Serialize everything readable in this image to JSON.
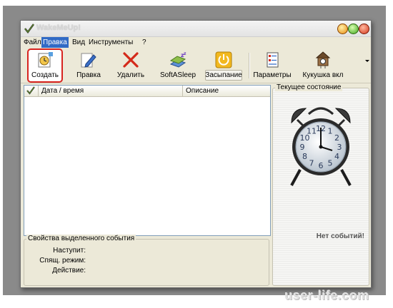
{
  "window": {
    "title": "WakeMeUp!"
  },
  "menu": [
    {
      "label": "Файл"
    },
    {
      "label": "Правка"
    },
    {
      "label": "Вид"
    },
    {
      "label": "Инструменты"
    },
    {
      "label": "?"
    }
  ],
  "toolbar": {
    "create": "Создать",
    "edit": "Правка",
    "delete": "Удалить",
    "softasleep": "SoftASleep",
    "sleep": "Засыпание",
    "params": "Параметры",
    "cuckoo": "Кукушка вкл"
  },
  "list": {
    "columns": {
      "date": "Дата / время",
      "desc": "Описание"
    }
  },
  "props": {
    "title": "Свойства выделенного события",
    "occurs": "Наступит:",
    "sleep_mode": "Спящ. режим:",
    "action": "Действие:"
  },
  "state": {
    "title": "Текущее состояние",
    "no_events": "Нет событий!",
    "clock_numbers": [
      "12",
      "1",
      "2",
      "3",
      "4",
      "5",
      "6",
      "7",
      "8",
      "9",
      "10",
      "11"
    ]
  },
  "watermark": "user-life.com"
}
